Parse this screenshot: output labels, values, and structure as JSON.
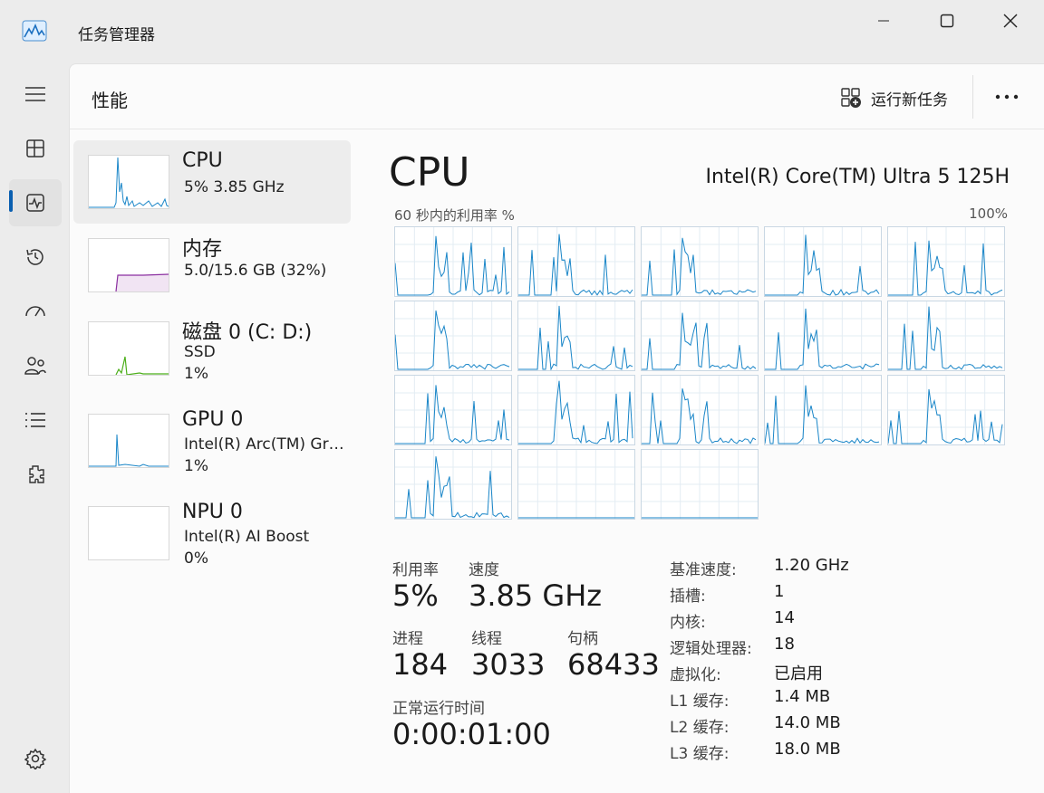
{
  "window": {
    "title": "任务管理器"
  },
  "header": {
    "page_title": "性能",
    "run_task_label": "运行新任务"
  },
  "nav": {
    "items": [
      "menu-icon",
      "processes-icon",
      "performance-icon",
      "app-history-icon",
      "startup-apps-icon",
      "users-icon",
      "details-icon",
      "services-icon"
    ],
    "active": "performance-icon",
    "settings": "settings-icon"
  },
  "devices": [
    {
      "name": "CPU",
      "sub1": "5%  3.85 GHz",
      "sub2": "",
      "color": "#1a86c8"
    },
    {
      "name": "内存",
      "sub1": "5.0/15.6 GB (32%)",
      "sub2": "",
      "color": "#8b2fa0"
    },
    {
      "name": "磁盘 0 (C: D:)",
      "sub1": "SSD",
      "sub2": "1%",
      "color": "#4caf1a"
    },
    {
      "name": "GPU 0",
      "sub1": "Intel(R) Arc(TM) Graphics",
      "sub2": "1%",
      "color": "#1a86c8"
    },
    {
      "name": "NPU 0",
      "sub1": "Intel(R) AI Boost",
      "sub2": "0%",
      "color": "#1a86c8"
    }
  ],
  "cpu": {
    "title": "CPU",
    "model": "Intel(R) Core(TM) Ultra 5 125H",
    "graph_caption": "60 秒内的利用率 %",
    "graph_max": "100%",
    "core_count": 18,
    "line_color": "#1a86c8"
  },
  "stats": {
    "utilization_label": "利用率",
    "utilization": "5%",
    "speed_label": "速度",
    "speed": "3.85 GHz",
    "processes_label": "进程",
    "processes": "184",
    "threads_label": "线程",
    "threads": "3033",
    "handles_label": "句柄",
    "handles": "68433",
    "uptime_label": "正常运行时间",
    "uptime": "0:00:01:00"
  },
  "specs": [
    {
      "label": "基准速度:",
      "value": "1.20 GHz"
    },
    {
      "label": "插槽:",
      "value": "1"
    },
    {
      "label": "内核:",
      "value": "14"
    },
    {
      "label": "逻辑处理器:",
      "value": "18"
    },
    {
      "label": "虚拟化:",
      "value": "已启用"
    },
    {
      "label": "L1 缓存:",
      "value": "1.4 MB"
    },
    {
      "label": "L2 缓存:",
      "value": "14.0 MB"
    },
    {
      "label": "L3 缓存:",
      "value": "18.0 MB"
    }
  ]
}
